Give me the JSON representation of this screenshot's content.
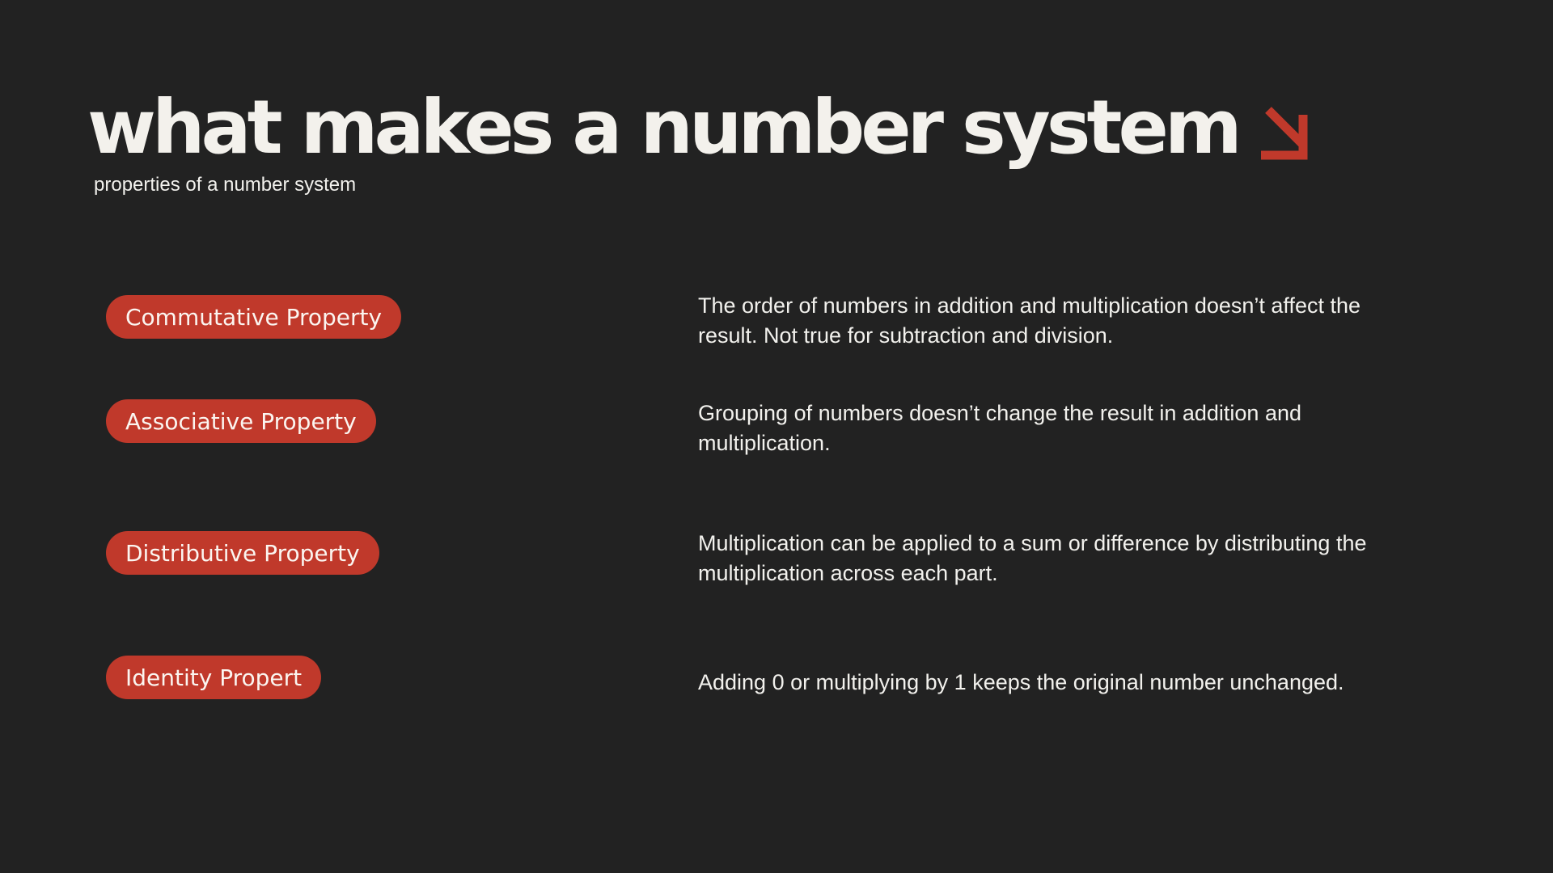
{
  "slide": {
    "title": "what makes a number system",
    "title_icon": "arrow-down-right-icon",
    "subtitle": "properties of a number system",
    "accent_color": "#c0392b",
    "background_color": "#222222",
    "text_color": "#f2f1ed",
    "properties": [
      {
        "label": "Commutative Property",
        "description": "The order of numbers in addition and multiplication doesn’t affect the result. Not true for subtraction and division."
      },
      {
        "label": "Associative Property",
        "description": "Grouping of numbers doesn’t change the result in addition and multiplication."
      },
      {
        "label": "Distributive Property",
        "description": "Multiplication can be applied to a sum or difference by distributing the multiplication across each part."
      },
      {
        "label": "Identity Propert",
        "description": "Adding 0 or multiplying by 1 keeps the original number unchanged."
      }
    ]
  }
}
